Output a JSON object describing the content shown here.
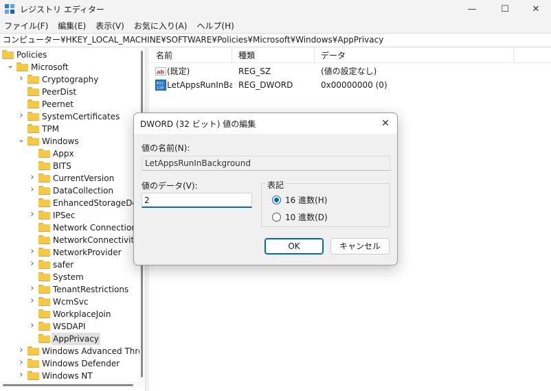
{
  "window": {
    "title": "レジストリ エディター",
    "minimize_glyph": "—",
    "maximize_glyph": "☐",
    "close_glyph": "✕"
  },
  "menu": [
    "ファイル(F)",
    "編集(E)",
    "表示(V)",
    "お気に入り(A)",
    "ヘルプ(H)"
  ],
  "address": "コンピューター¥HKEY_LOCAL_MACHINE¥SOFTWARE¥Policies¥Microsoft¥Windows¥AppPrivacy",
  "tree": [
    {
      "label": "Policies",
      "depth": 0,
      "chevron": "",
      "selected": false
    },
    {
      "label": "Microsoft",
      "depth": 1,
      "chevron": "down",
      "selected": false
    },
    {
      "label": "Cryptography",
      "depth": 2,
      "chevron": "right",
      "selected": false
    },
    {
      "label": "PeerDist",
      "depth": 2,
      "chevron": "",
      "selected": false
    },
    {
      "label": "Peernet",
      "depth": 2,
      "chevron": "",
      "selected": false
    },
    {
      "label": "SystemCertificates",
      "depth": 2,
      "chevron": "right",
      "selected": false
    },
    {
      "label": "TPM",
      "depth": 2,
      "chevron": "",
      "selected": false
    },
    {
      "label": "Windows",
      "depth": 2,
      "chevron": "down",
      "selected": false
    },
    {
      "label": "Appx",
      "depth": 3,
      "chevron": "",
      "selected": false
    },
    {
      "label": "BITS",
      "depth": 3,
      "chevron": "",
      "selected": false
    },
    {
      "label": "CurrentVersion",
      "depth": 3,
      "chevron": "right",
      "selected": false
    },
    {
      "label": "DataCollection",
      "depth": 3,
      "chevron": "right",
      "selected": false
    },
    {
      "label": "EnhancedStorageDevices",
      "depth": 3,
      "chevron": "",
      "selected": false
    },
    {
      "label": "IPSec",
      "depth": 3,
      "chevron": "right",
      "selected": false
    },
    {
      "label": "Network Connections",
      "depth": 3,
      "chevron": "",
      "selected": false
    },
    {
      "label": "NetworkConnectivityStatusIndicator",
      "depth": 3,
      "chevron": "",
      "selected": false
    },
    {
      "label": "NetworkProvider",
      "depth": 3,
      "chevron": "right",
      "selected": false
    },
    {
      "label": "safer",
      "depth": 3,
      "chevron": "right",
      "selected": false
    },
    {
      "label": "System",
      "depth": 3,
      "chevron": "",
      "selected": false
    },
    {
      "label": "TenantRestrictions",
      "depth": 3,
      "chevron": "right",
      "selected": false
    },
    {
      "label": "WcmSvc",
      "depth": 3,
      "chevron": "right",
      "selected": false
    },
    {
      "label": "WorkplaceJoin",
      "depth": 3,
      "chevron": "",
      "selected": false
    },
    {
      "label": "WSDAPI",
      "depth": 3,
      "chevron": "right",
      "selected": false
    },
    {
      "label": "AppPrivacy",
      "depth": 3,
      "chevron": "",
      "selected": true
    },
    {
      "label": "Windows Advanced Threat Protection",
      "depth": 2,
      "chevron": "right",
      "selected": false
    },
    {
      "label": "Windows Defender",
      "depth": 2,
      "chevron": "right",
      "selected": false
    },
    {
      "label": "Windows NT",
      "depth": 2,
      "chevron": "right",
      "selected": false
    }
  ],
  "list": {
    "headers": [
      "名前",
      "種類",
      "データ"
    ],
    "rows": [
      {
        "icon": "string-value-icon",
        "name": "(既定)",
        "type": "REG_SZ",
        "data": "(値の設定なし)"
      },
      {
        "icon": "binary-value-icon",
        "name": "LetAppsRunInBa...",
        "type": "REG_DWORD",
        "data": "0x00000000 (0)"
      }
    ]
  },
  "dialog": {
    "title": "DWORD (32 ビット) 値の編集",
    "close_glyph": "✕",
    "value_name_label": "値の名前(N):",
    "value_name": "LetAppsRunInBackground",
    "value_data_label": "値のデータ(V):",
    "value_data": "2",
    "base_label": "表記",
    "radio_hex": "16 進数(H)",
    "radio_dec": "10 進数(D)",
    "selected_base": "hex",
    "ok_label": "OK",
    "cancel_label": "キャンセル"
  },
  "colors": {
    "accent": "#0067c0",
    "folder": "#f6c944",
    "selection": "#e1e1e1"
  }
}
